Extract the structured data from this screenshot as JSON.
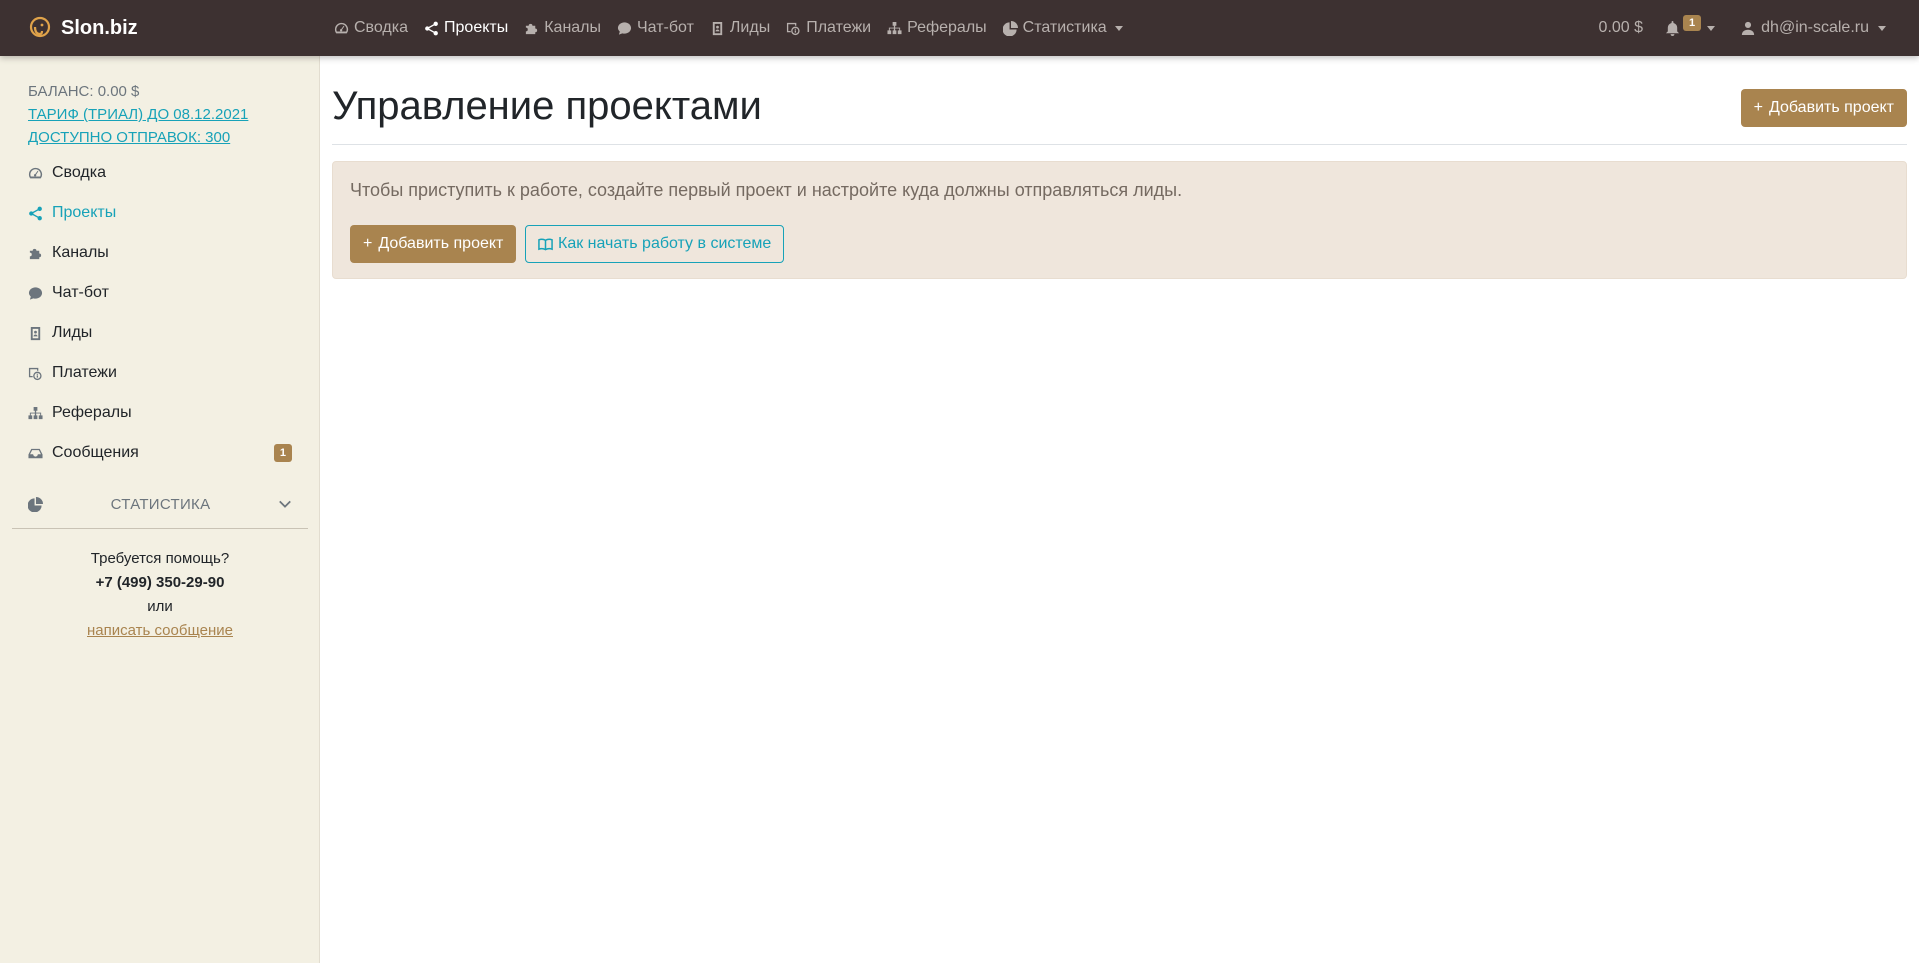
{
  "brand": {
    "name": "Slon.biz"
  },
  "nav": {
    "items": [
      {
        "label": "Сводка",
        "icon": "gauge-icon"
      },
      {
        "label": "Проекты",
        "icon": "share-icon",
        "active": true
      },
      {
        "label": "Каналы",
        "icon": "puzzle-icon"
      },
      {
        "label": "Чат-бот",
        "icon": "chat-icon"
      },
      {
        "label": "Лиды",
        "icon": "contact-book-icon"
      },
      {
        "label": "Платежи",
        "icon": "payment-icon"
      },
      {
        "label": "Рефералы",
        "icon": "sitemap-icon"
      },
      {
        "label": "Статистика",
        "icon": "pie-chart-icon",
        "dropdown": true
      }
    ],
    "balance": "0.00 $",
    "notifications_count": "1",
    "user_email": "dh@in-scale.ru"
  },
  "sidebar": {
    "balance": "БАЛАНС: 0.00 $",
    "tariff_link": "ТАРИФ (ТРИАЛ) ДО 08.12.2021",
    "sends_link": "ДОСТУПНО ОТПРАВОК: 300",
    "items": [
      {
        "label": "Сводка"
      },
      {
        "label": "Проекты"
      },
      {
        "label": "Каналы"
      },
      {
        "label": "Чат-бот"
      },
      {
        "label": "Лиды"
      },
      {
        "label": "Платежи"
      },
      {
        "label": "Рефералы"
      },
      {
        "label": "Сообщения",
        "badge": "1"
      }
    ],
    "stats_label": "Статистика",
    "help_title": "Требуется помощь?",
    "help_phone": "+7 (499) 350-29-90",
    "help_or": "или",
    "help_link": "написать сообщение"
  },
  "main": {
    "title": "Управление проектами",
    "add_button": "Добавить проект",
    "alert_text": "Чтобы приступить к работе, создайте первый проект и настройте куда должны отправляться лиды.",
    "alert_add_button": "Добавить проект",
    "alert_howto_button": "Как начать работу в системе"
  },
  "colors": {
    "navbar": "#3d3131",
    "sidebar": "#f3f0e3",
    "accent": "#a9844f",
    "link": "#17a2b8",
    "alert_bg": "#efe6dc"
  }
}
